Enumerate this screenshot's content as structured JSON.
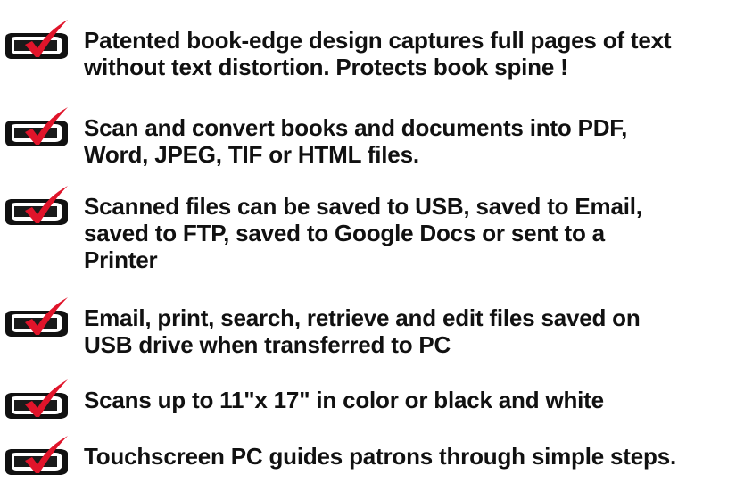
{
  "colors": {
    "box": "#111111",
    "box_face": "#1a1a1a",
    "check": "#e0142a"
  },
  "features": {
    "icon_name": "checkbox-check-icon",
    "items": [
      {
        "text": "Patented book-edge design captures full pages of text\nwithout text distortion. Protects book spine !"
      },
      {
        "text": "Scan and convert books and documents into PDF,\nWord, JPEG, TIF or HTML files."
      },
      {
        "text": "Scanned files can be saved to USB, saved to Email,\nsaved to FTP, saved to Google Docs or sent to a\nPrinter"
      },
      {
        "text": "Email, print, search, retrieve and edit files saved on\nUSB drive when transferred to PC"
      },
      {
        "text": "Scans up to 11\"x 17\" in color or black and white"
      },
      {
        "text": "Touchscreen PC guides patrons through simple steps."
      }
    ]
  }
}
